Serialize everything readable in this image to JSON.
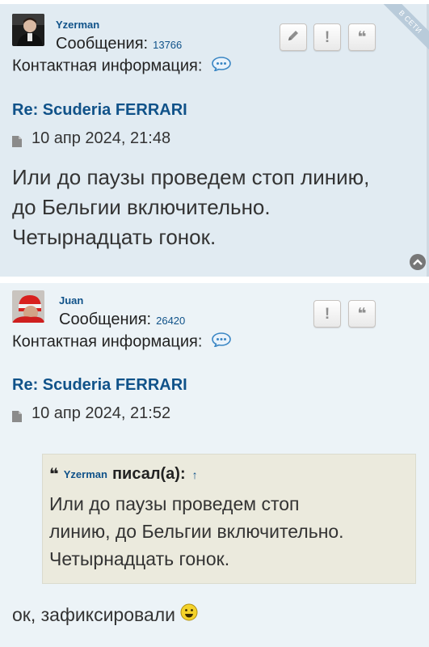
{
  "posts": [
    {
      "username": "Yzerman",
      "messages_label": "Сообщения:",
      "messages_count": "13766",
      "contact_label": "Контактная информация:",
      "status_badge": "В СЕТИ",
      "title": "Re: Scuderia FERRARI",
      "date": "10 апр 2024, 21:48",
      "body_lines": [
        "Или до паузы проведем стоп линию,",
        "до Бельгии включительно.",
        "Четырнадцать гонок."
      ],
      "buttons": [
        "edit-icon",
        "report-icon",
        "quote-icon"
      ]
    },
    {
      "username": "Juan",
      "messages_label": "Сообщения:",
      "messages_count": "26420",
      "contact_label": "Контактная информация:",
      "title": "Re: Scuderia FERRARI",
      "date": "10 апр 2024, 21:52",
      "quote": {
        "author": "Yzerman",
        "wrote": "писал(а):",
        "up_arrow": "↑",
        "lines": [
          "Или до паузы проведем стоп",
          "линию, до Бельгии включительно.",
          "Четырнадцать гонок."
        ]
      },
      "reply": "ок, зафиксировали",
      "buttons": [
        "report-icon",
        "quote-icon"
      ]
    }
  ],
  "colors": {
    "post1_bg": "#e1ebf2",
    "post2_bg": "#ecf3f7",
    "link": "#105289",
    "quote_bg": "#ebeadd"
  }
}
